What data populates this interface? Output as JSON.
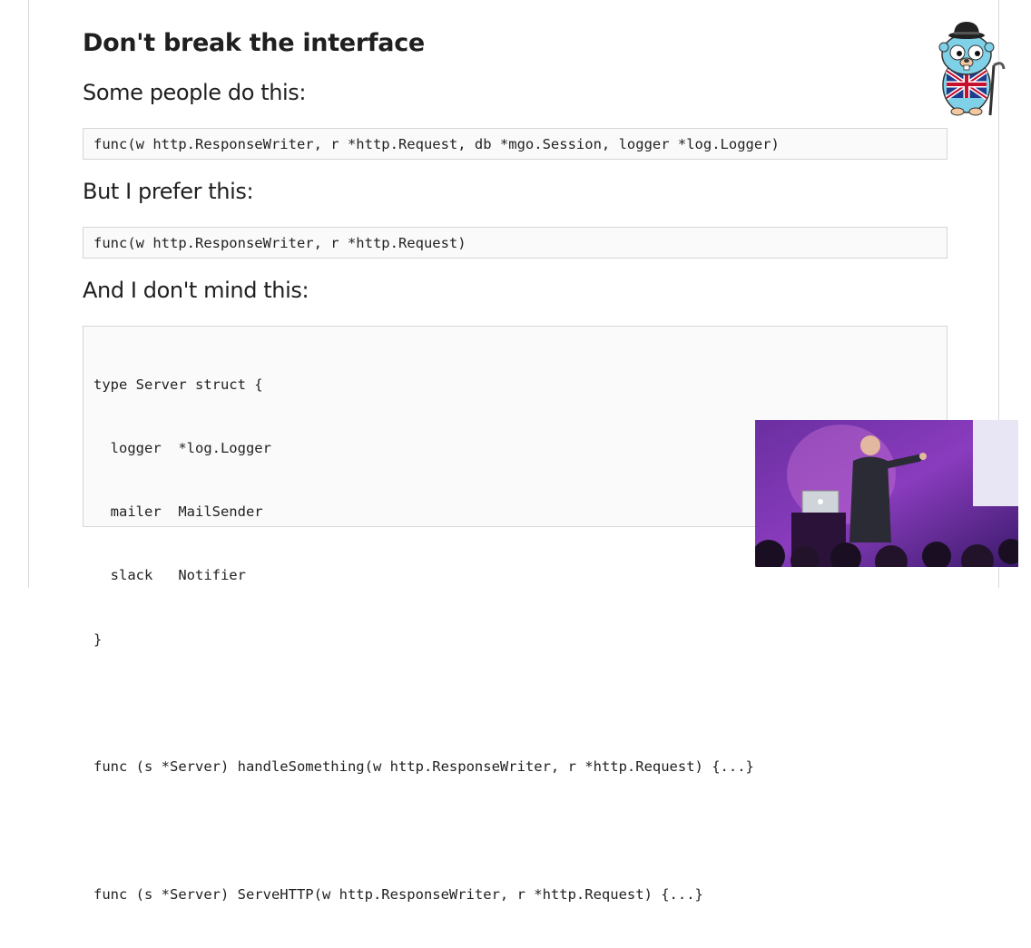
{
  "slide": {
    "title": "Don't break the interface",
    "heading1": "Some people do this:",
    "code1": "func(w http.ResponseWriter, r *http.Request, db *mgo.Session, logger *log.Logger)",
    "heading2": "But I prefer this:",
    "code2": "func(w http.ResponseWriter, r *http.Request)",
    "heading3": "And I don't mind this:",
    "code3_lines": [
      "type Server struct {",
      "  logger  *log.Logger",
      "  mailer  MailSender",
      "  slack   Notifier",
      "}",
      "",
      "func (s *Server) handleSomething(w http.ResponseWriter, r *http.Request) {...}",
      "",
      "func (s *Server) ServeHTTP(w http.ResponseWriter, r *http.Request) {...}"
    ]
  },
  "icons": {
    "mascot": "gopher-mascot-icon",
    "video": "speaker-video-feed"
  },
  "colors": {
    "code_bg": "#fafafa",
    "code_border": "#d6d6d6",
    "video_purple": "#5a2a8a"
  }
}
